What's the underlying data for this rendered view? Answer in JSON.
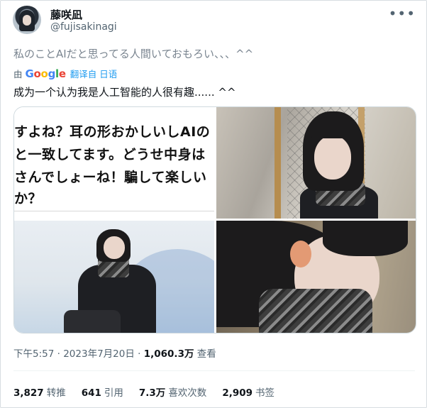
{
  "author": {
    "name": "藤咲凪",
    "handle": "@fujisakinagi"
  },
  "tweet": {
    "text": "私のことAIだと思ってる人間いておもろい、、、^^",
    "translation_prefix": "由",
    "translation_provider": "Google",
    "translation_link": "翻译自 日语",
    "translated_text": "成为一个认为我是人工智能的人很有趣...... ^^"
  },
  "media": {
    "screenshot_lines": [
      "すよね？耳の形おかしいしAIの",
      "と一致してます。どうせ中身は",
      "さんでしょーね！騙して楽しい",
      "か？"
    ]
  },
  "meta": {
    "time": "下午5:57",
    "separator1": "·",
    "date": "2023年7月20日",
    "separator2": "·",
    "views_count": "1,060.3万",
    "views_label": "查看"
  },
  "stats": [
    {
      "value": "3,827",
      "label": "转推"
    },
    {
      "value": "641",
      "label": "引用"
    },
    {
      "value": "7.3万",
      "label": "喜欢次数"
    },
    {
      "value": "2,909",
      "label": "书签"
    }
  ],
  "icons": {
    "more": "more-horizontal-icon"
  }
}
